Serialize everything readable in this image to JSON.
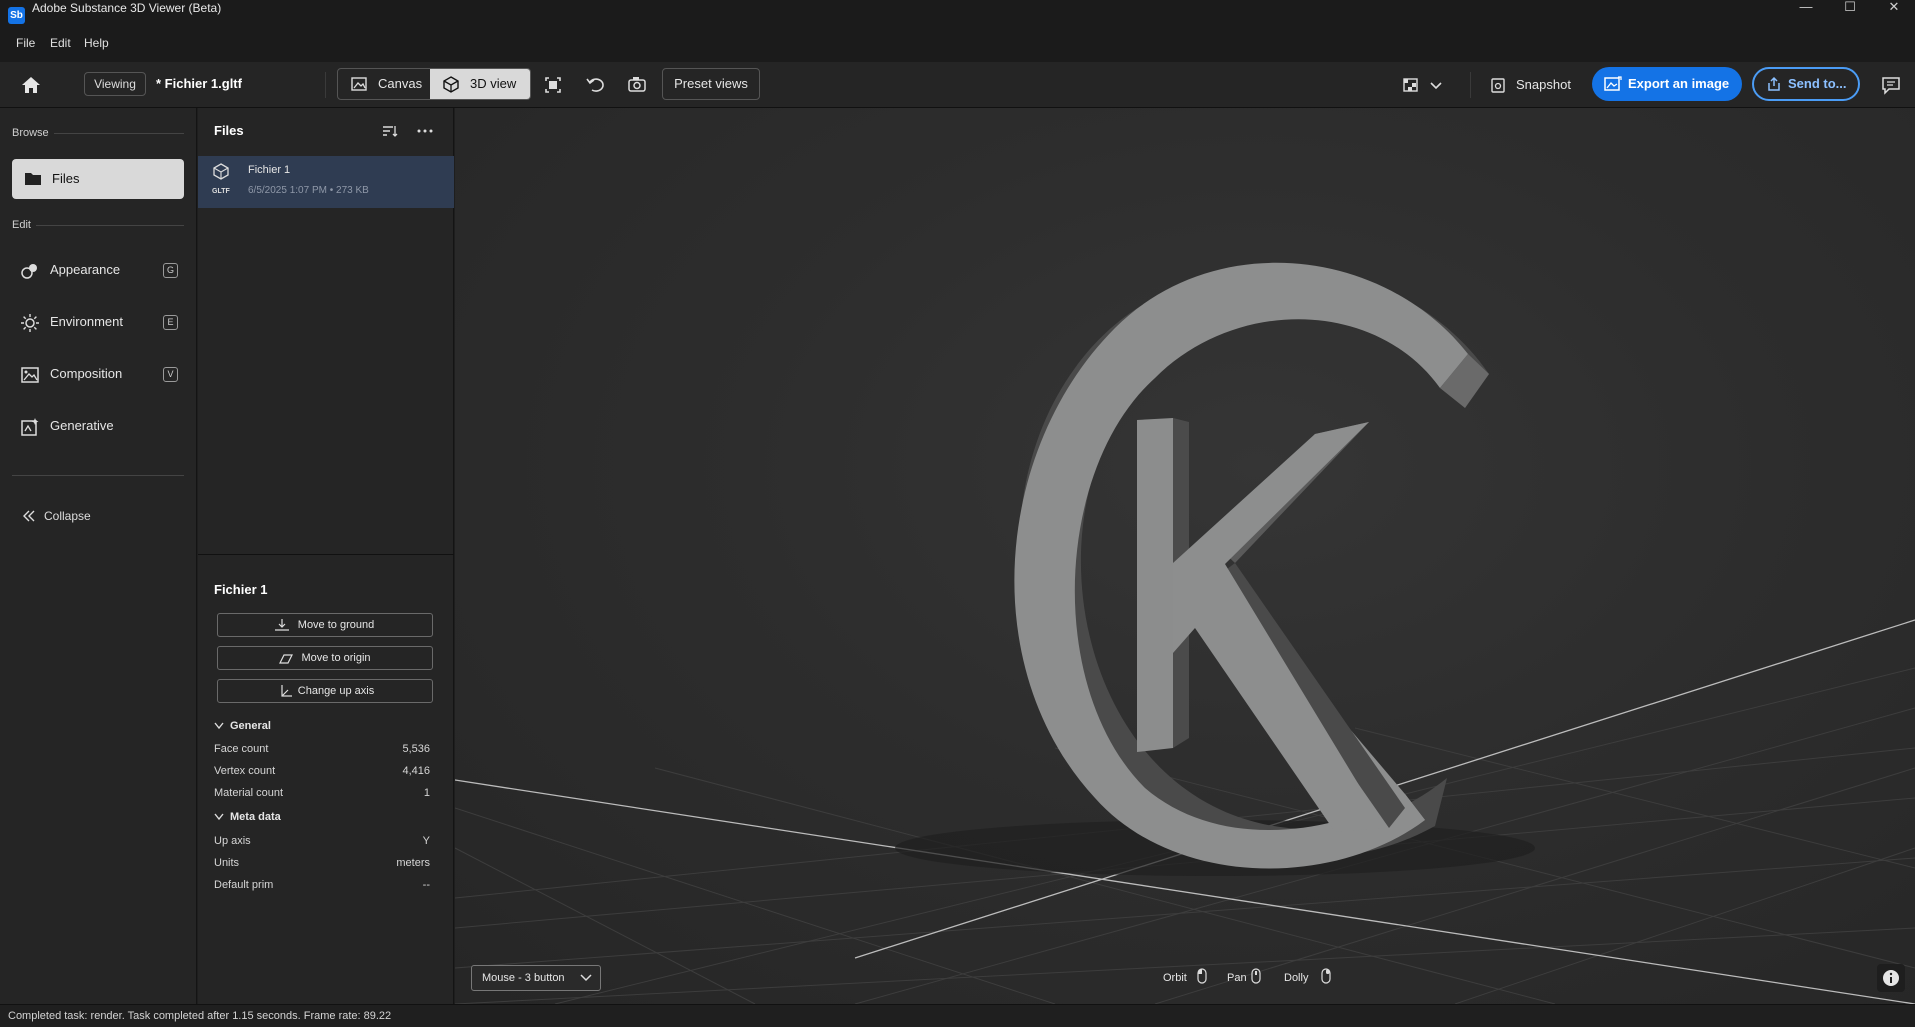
{
  "window": {
    "title": "Adobe Substance 3D Viewer (Beta)",
    "logo_text": "Sb",
    "minimize": "—",
    "maximize": "☐",
    "close": "✕"
  },
  "menu": [
    "File",
    "Edit",
    "Help"
  ],
  "toolbar": {
    "viewing_label": "Viewing",
    "file_title": "* Fichier 1.gltf",
    "canvas_label": "Canvas",
    "view3d_label": "3D view",
    "preset_views_label": "Preset views",
    "snapshot_label": "Snapshot",
    "export_label": "Export an image",
    "send_label": "Send to..."
  },
  "sidebar": {
    "browse_label": "Browse",
    "files_label": "Files",
    "edit_label": "Edit",
    "items": [
      {
        "label": "Appearance",
        "key": "G"
      },
      {
        "label": "Environment",
        "key": "E"
      },
      {
        "label": "Composition",
        "key": "V"
      },
      {
        "label": "Generative",
        "key": ""
      }
    ],
    "collapse_label": "Collapse"
  },
  "files_panel": {
    "header": "Files",
    "file": {
      "name": "Fichier 1",
      "format": "GLTF",
      "meta": "6/5/2025 1:07 PM • 273 KB"
    },
    "props_title": "Fichier 1",
    "actions": [
      "Move to ground",
      "Move to origin",
      "Change up axis"
    ],
    "general": {
      "header": "General",
      "rows": [
        {
          "label": "Face count",
          "value": "5,536"
        },
        {
          "label": "Vertex count",
          "value": "4,416"
        },
        {
          "label": "Material count",
          "value": "1"
        }
      ]
    },
    "meta": {
      "header": "Meta data",
      "rows": [
        {
          "label": "Up axis",
          "value": "Y"
        },
        {
          "label": "Units",
          "value": "meters"
        },
        {
          "label": "Default prim",
          "value": "--"
        }
      ]
    }
  },
  "viewport": {
    "mouse_mode": "Mouse - 3 button",
    "hints": [
      "Orbit",
      "Pan",
      "Dolly"
    ]
  },
  "status": {
    "text": "Completed task: render. Task completed after 1.15 seconds. Frame rate: 89.22"
  },
  "colors": {
    "accent": "#1473e6",
    "selected_row": "#2f3c52",
    "model_face": "#8e8f8f"
  }
}
